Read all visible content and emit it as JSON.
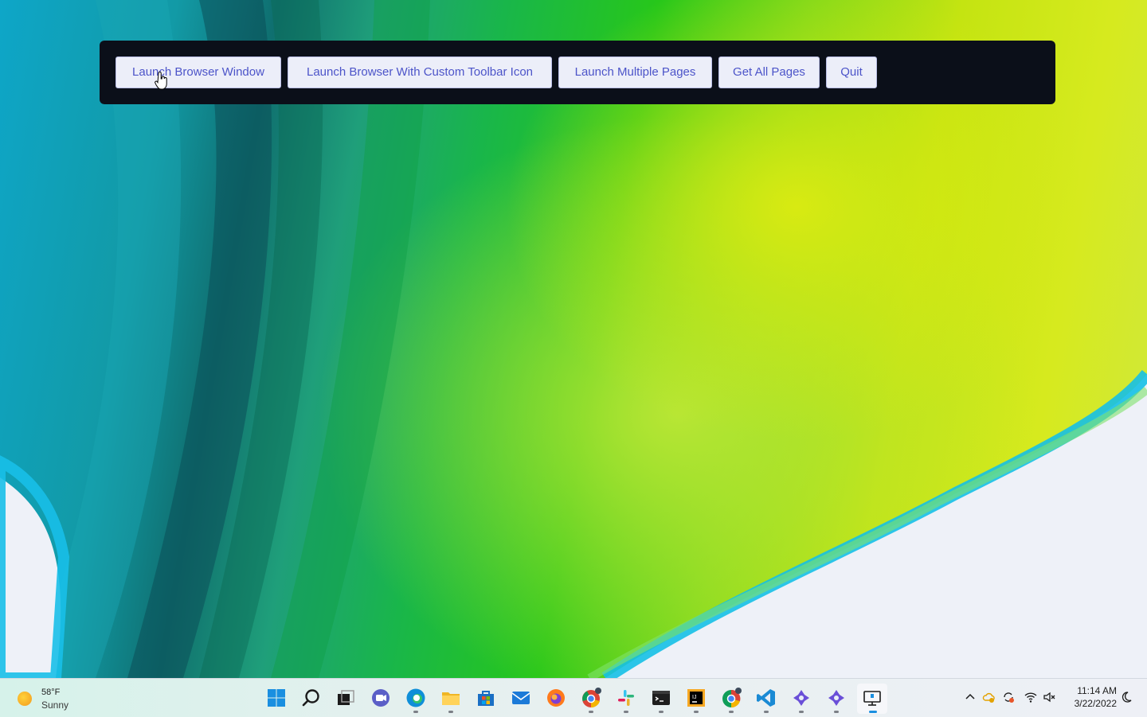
{
  "toolbar": {
    "buttons": [
      {
        "label": "Launch Browser Window"
      },
      {
        "label": "Launch Browser With Custom Toolbar Icon"
      },
      {
        "label": "Launch Multiple Pages"
      },
      {
        "label": "Get All Pages"
      },
      {
        "label": "Quit"
      }
    ]
  },
  "taskbar": {
    "weather": {
      "temp": "58°F",
      "condition": "Sunny",
      "icon": "sun-icon"
    },
    "pinned": [
      {
        "name": "start-icon"
      },
      {
        "name": "search-icon"
      },
      {
        "name": "task-view-icon"
      },
      {
        "name": "teams-chat-icon"
      },
      {
        "name": "edge-icon"
      },
      {
        "name": "file-explorer-icon"
      },
      {
        "name": "store-icon"
      },
      {
        "name": "mail-icon"
      },
      {
        "name": "firefox-icon"
      },
      {
        "name": "chrome-icon"
      },
      {
        "name": "slack-icon"
      },
      {
        "name": "terminal-icon"
      },
      {
        "name": "jetbrains-icon"
      },
      {
        "name": "chrome-profile-icon"
      },
      {
        "name": "vscode-icon"
      },
      {
        "name": "app-icon"
      },
      {
        "name": "app-icon"
      },
      {
        "name": "remote-desktop-icon"
      }
    ],
    "tray": [
      "chevron-up-icon",
      "cloud-icon",
      "sync-icon",
      "wifi-icon",
      "volume-muted-icon"
    ],
    "clock": {
      "time": "11:14 AM",
      "date": "3/22/2022"
    },
    "notification_icon": "moon-icon"
  },
  "colors": {
    "toolbar_bg": "#0b0f19",
    "button_bg": "#eceef9",
    "button_text": "#4c54c9"
  }
}
